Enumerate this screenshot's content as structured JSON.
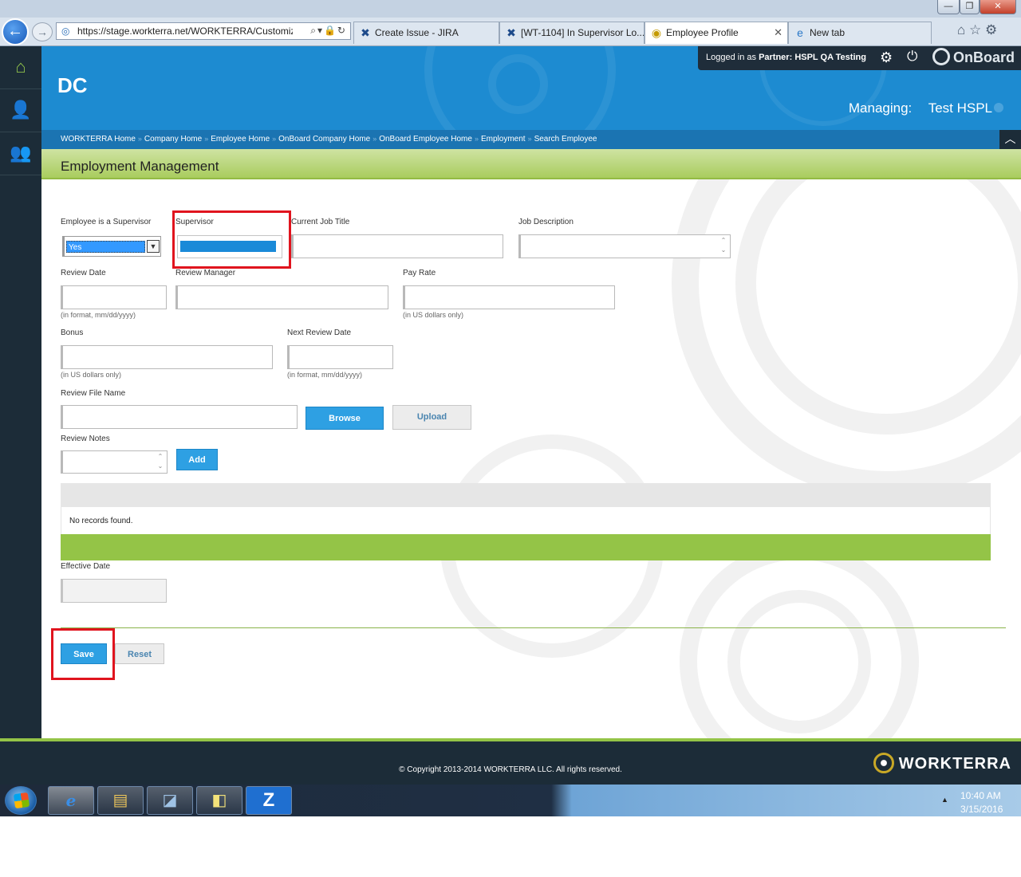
{
  "browser": {
    "url": "https://stage.workterra.net/WORKTERRA/Customiz",
    "tabs": [
      {
        "label": "Create Issue - JIRA"
      },
      {
        "label": "[WT-1104] In Supervisor Lo..."
      },
      {
        "label": "Employee Profile"
      },
      {
        "label": "New tab"
      }
    ]
  },
  "userbar": {
    "prefix": "Logged in as",
    "partner_label": "Partner:",
    "partner_name": "HSPL QA Testing",
    "app_name": "OnBoard"
  },
  "header": {
    "title": "DC",
    "managing_label": "Managing:",
    "managing_value": "Test HSPL"
  },
  "breadcrumb": [
    "WORKTERRA Home",
    "Company Home",
    "Employee Home",
    "OnBoard Company Home",
    "OnBoard Employee Home",
    "Employment",
    "Search Employee"
  ],
  "section": {
    "title": "Employment Management"
  },
  "form": {
    "is_supervisor_label": "Employee is a Supervisor",
    "is_supervisor_value": "Yes",
    "supervisor_label": "Supervisor",
    "job_title_label": "Current Job Title",
    "job_description_label": "Job Description",
    "review_date_label": "Review Date",
    "review_date_hint": "(in format, mm/dd/yyyy)",
    "review_manager_label": "Review Manager",
    "pay_rate_label": "Pay Rate",
    "pay_rate_hint": "(in US dollars only)",
    "bonus_label": "Bonus",
    "bonus_hint": "(in US dollars only)",
    "next_review_label": "Next Review Date",
    "next_review_hint": "(in format, mm/dd/yyyy)",
    "review_file_label": "Review File Name",
    "browse_label": "Browse",
    "upload_label": "Upload",
    "review_notes_label": "Review Notes",
    "add_label": "Add",
    "no_records": "No records found.",
    "effective_date_label": "Effective Date",
    "save_label": "Save",
    "reset_label": "Reset"
  },
  "footer": {
    "copyright": "© Copyright 2013-2014 WORKTERRA LLC. All rights reserved.",
    "brand": "WORKTERRA"
  },
  "taskbar": {
    "time": "10:40 AM",
    "date": "3/15/2016"
  },
  "colors": {
    "header_blue": "#1d8bd1",
    "breadcrumb_blue": "#1b74b2",
    "accent_green": "#94c447",
    "nav_dark": "#1c2c38",
    "button_blue": "#2ea0e3",
    "annotation_red": "#e0141e"
  }
}
